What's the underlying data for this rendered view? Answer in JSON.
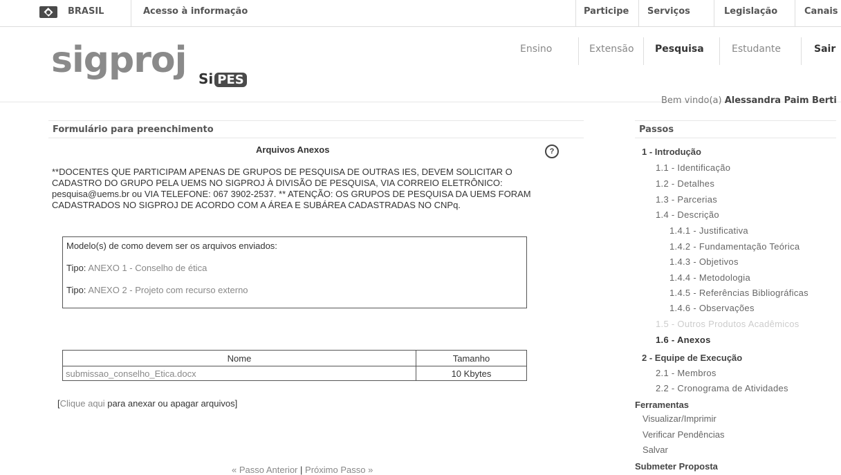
{
  "govbar": {
    "brasil": "BRASIL",
    "acesso": "Acesso à informação",
    "links": [
      "Participe",
      "Serviços",
      "Legislação",
      "Canais"
    ]
  },
  "header": {
    "logo_text": "sigproj",
    "sub_logo_prefix": "Si",
    "sub_logo_badge": "PES",
    "nav": [
      "Ensino",
      "Extensão",
      "Pesquisa",
      "Estudante",
      "Sair"
    ],
    "active_nav": "Pesquisa",
    "welcome_prefix": "Bem vindo(a)",
    "welcome_user": "Alessandra Paim Berti"
  },
  "main": {
    "section_title": "Formulário para preenchimento",
    "anexos_title": "Arquivos Anexos",
    "help_glyph": "?",
    "notice": "**DOCENTES QUE PARTICIPAM APENAS DE GRUPOS DE PESQUISA DE OUTRAS IES, DEVEM SOLICITAR O CADASTRO DO GRUPO PELA UEMS NO SIGPROJ À DIVISÃO DE PESQUISA, VIA CORREIO ELETRÔNICO: pesquisa@uems.br ou VIA TELEFONE: 067 3902-2537. ** ATENÇÃO: OS GRUPOS DE PESQUISA DA UEMS FORAM CADASTRADOS NO SIGPROJ DE ACORDO COM A ÁREA E SUBÁREA CADASTRADAS NO CNPq.",
    "modelo_heading": "Modelo(s) de como devem ser os arquivos enviados:",
    "modelo_items": [
      {
        "label": "Tipo:",
        "value": "ANEXO 1 - Conselho de ética"
      },
      {
        "label": "Tipo:",
        "value": "ANEXO 2 - Projeto com recurso externo"
      }
    ],
    "table": {
      "headers": [
        "Nome",
        "Tamanho"
      ],
      "rows": [
        [
          "submissao_conselho_Etica.docx",
          "10 Kbytes"
        ]
      ]
    },
    "clique_open": "[",
    "clique_link": "Clique aqui",
    "clique_rest": "para anexar ou apagar arquivos]",
    "pager_prev": "« Passo Anterior",
    "pager_sep": "|",
    "pager_next": "Próximo Passo »"
  },
  "sidebar": {
    "title": "Passos",
    "steps": [
      {
        "label": "1 - Introdução",
        "level": 1
      },
      {
        "label": "1.1 - Identificação",
        "level": 2
      },
      {
        "label": "1.2 - Detalhes",
        "level": 2
      },
      {
        "label": "1.3 - Parcerias",
        "level": 2
      },
      {
        "label": "1.4 - Descrição",
        "level": 2
      },
      {
        "label": "1.4.1 - Justificativa",
        "level": 3
      },
      {
        "label": "1.4.2 - Fundamentação Teórica",
        "level": 3
      },
      {
        "label": "1.4.3 - Objetivos",
        "level": 3
      },
      {
        "label": "1.4.4 - Metodologia",
        "level": 3
      },
      {
        "label": "1.4.5 - Referências Bibliográficas",
        "level": 3
      },
      {
        "label": "1.4.6 - Observações",
        "level": 3
      },
      {
        "label": "1.5 - Outros Produtos Acadêmicos",
        "level": 2,
        "state": "disabled"
      },
      {
        "label": "1.6 - Anexos",
        "level": 2,
        "state": "current"
      },
      {
        "label": "2 - Equipe de Execução",
        "level": 1
      },
      {
        "label": "2.1 - Membros",
        "level": 2
      },
      {
        "label": "2.2 - Cronograma de Atividades",
        "level": 2
      }
    ],
    "tools_title": "Ferramentas",
    "tools": [
      "Visualizar/Imprimir",
      "Verificar Pendências",
      "Salvar"
    ],
    "submit_title": "Submeter Proposta"
  }
}
